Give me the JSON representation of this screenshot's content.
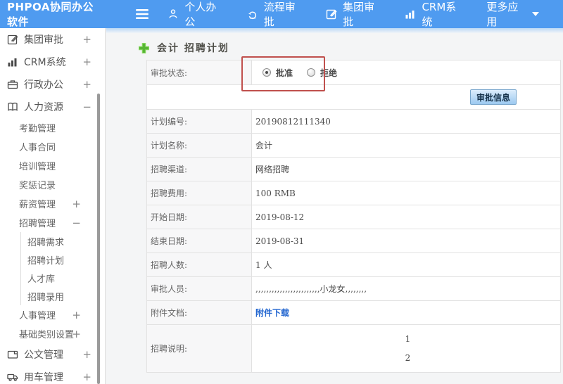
{
  "topbar": {
    "logo": "PHPOA协同办公软件",
    "nav": [
      {
        "icon": "user-icon",
        "label": "个人办公"
      },
      {
        "icon": "flow-arrow-icon",
        "label": "流程审批"
      },
      {
        "icon": "edit-square-icon",
        "label": "集团审批"
      },
      {
        "icon": "bar-chart-icon",
        "label": "CRM系统"
      },
      {
        "icon": "caret-down-icon",
        "label": "更多应用"
      }
    ]
  },
  "sidebar": {
    "items": [
      {
        "label": "集团审批",
        "icon": "edit-square-icon",
        "expand": "+",
        "level": 1
      },
      {
        "label": "CRM系统",
        "icon": "bar-chart-icon",
        "expand": "+",
        "level": 1
      },
      {
        "label": "行政办公",
        "icon": "briefcase-icon",
        "expand": "+",
        "level": 1
      },
      {
        "label": "人力资源",
        "icon": "book-icon",
        "expand": "−",
        "level": 1
      },
      {
        "label": "考勤管理",
        "level": 2
      },
      {
        "label": "人事合同",
        "level": 2
      },
      {
        "label": "培训管理",
        "level": 2
      },
      {
        "label": "奖惩记录",
        "level": 2
      },
      {
        "label": "薪资管理",
        "expand": "+",
        "level": 2
      },
      {
        "label": "招聘管理",
        "expand": "−",
        "level": 2
      },
      {
        "label": "招聘需求",
        "level": 3
      },
      {
        "label": "招聘计划",
        "level": 3
      },
      {
        "label": "人才库",
        "level": 3
      },
      {
        "label": "招聘录用",
        "level": 3
      },
      {
        "label": "人事管理",
        "expand": "+",
        "level": 2
      },
      {
        "label": "基础类别设置",
        "expand": "+",
        "level": 2
      },
      {
        "label": "公文管理",
        "icon": "document-icon",
        "expand": "+",
        "level": 1
      },
      {
        "label": "用车管理",
        "icon": "truck-icon",
        "expand": "+",
        "level": 1
      }
    ]
  },
  "main": {
    "title": "会计 招聘计划",
    "form": {
      "status_label": "审批状态:",
      "radios": [
        {
          "label": "批准",
          "checked": true
        },
        {
          "label": "拒绝",
          "checked": false
        }
      ],
      "button_label": "审批信息",
      "rows": [
        {
          "label": "计划编号:",
          "value": "20190812111340"
        },
        {
          "label": "计划名称:",
          "value": "会计"
        },
        {
          "label": "招聘渠道:",
          "value": "网络招聘"
        },
        {
          "label": "招聘费用:",
          "value": "100 RMB"
        },
        {
          "label": "开始日期:",
          "value": "2019-08-12"
        },
        {
          "label": "结束日期:",
          "value": "2019-08-31"
        },
        {
          "label": "招聘人数:",
          "value": "1 人"
        },
        {
          "label": "审批人员:",
          "value": ",,,,,,,,,,,,,,,,,,,,,,,,小龙女,,,,,,,,"
        },
        {
          "label": "附件文档:",
          "value": "附件下载"
        },
        {
          "label": "招聘说明:",
          "lines": [
            "1",
            "2"
          ]
        }
      ]
    }
  },
  "colors": {
    "topbar_blue": "#4f9bf0",
    "red_annotation": "#c0504d",
    "link_blue": "#2467d0",
    "green_plus": "#57b635",
    "button_face_top": "#dcedfc",
    "button_face_bottom": "#9cc9f0",
    "label_cell_bg": "#f7f7f8"
  }
}
